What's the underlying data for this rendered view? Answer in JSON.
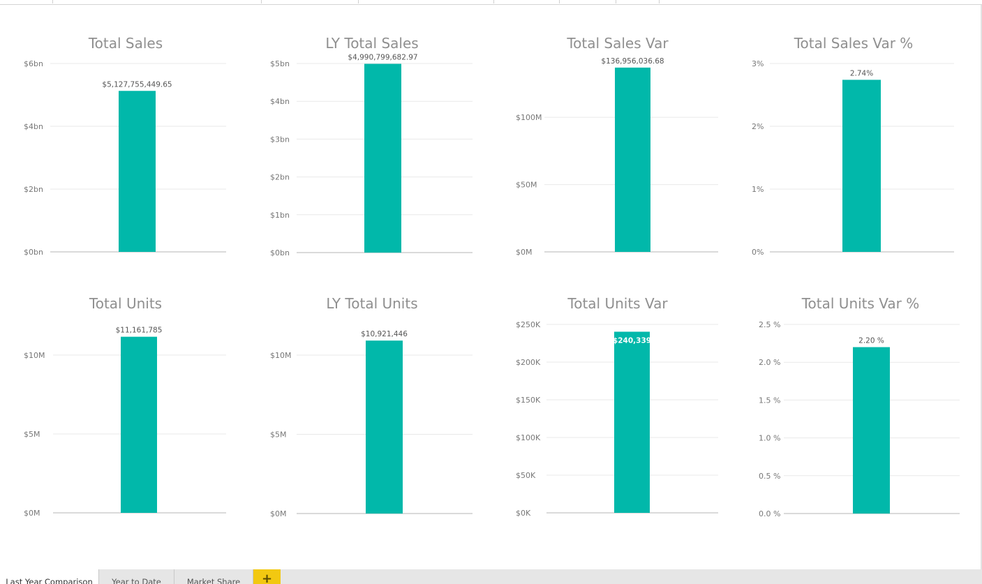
{
  "report": {
    "tabs": [
      {
        "label": "Last Year Comparison",
        "active": true
      },
      {
        "label": "Year to Date",
        "active": false
      },
      {
        "label": "Market Share",
        "active": false
      }
    ],
    "add_tab_label": "+",
    "bar_color": "#01b8aa"
  },
  "chart_data": [
    {
      "type": "bar",
      "title": "Total Sales",
      "categories": [
        ""
      ],
      "values": [
        5127755449.65
      ],
      "data_label": "$5,127,755,449.65",
      "ylim": [
        0,
        6000000000
      ],
      "yticks": [
        {
          "value": 0,
          "label": "$0bn"
        },
        {
          "value": 2000000000,
          "label": "$2bn"
        },
        {
          "value": 4000000000,
          "label": "$4bn"
        },
        {
          "value": 6000000000,
          "label": "$6bn"
        }
      ],
      "grid": true
    },
    {
      "type": "bar",
      "title": "LY Total Sales",
      "categories": [
        ""
      ],
      "values": [
        4990799682.97
      ],
      "data_label": "$4,990,799,682.97",
      "ylim": [
        0,
        5000000000
      ],
      "yticks": [
        {
          "value": 0,
          "label": "$0bn"
        },
        {
          "value": 1000000000,
          "label": "$1bn"
        },
        {
          "value": 2000000000,
          "label": "$2bn"
        },
        {
          "value": 3000000000,
          "label": "$3bn"
        },
        {
          "value": 4000000000,
          "label": "$4bn"
        },
        {
          "value": 5000000000,
          "label": "$5bn"
        }
      ],
      "grid": true
    },
    {
      "type": "bar",
      "title": "Total Sales Var",
      "categories": [
        ""
      ],
      "values": [
        136956036.68
      ],
      "data_label": "$136,956,036.68",
      "ylim": [
        0,
        140000000
      ],
      "yticks": [
        {
          "value": 0,
          "label": "$0M"
        },
        {
          "value": 50000000,
          "label": "$50M"
        },
        {
          "value": 100000000,
          "label": "$100M"
        }
      ],
      "grid": true
    },
    {
      "type": "bar",
      "title": "Total Sales Var %",
      "categories": [
        ""
      ],
      "values": [
        2.74
      ],
      "data_label": "2.74%",
      "ylim": [
        0,
        3
      ],
      "yticks": [
        {
          "value": 0,
          "label": "0%"
        },
        {
          "value": 1,
          "label": "1%"
        },
        {
          "value": 2,
          "label": "2%"
        },
        {
          "value": 3,
          "label": "3%"
        }
      ],
      "grid": true
    },
    {
      "type": "bar",
      "title": "Total Units",
      "categories": [
        ""
      ],
      "values": [
        11161785
      ],
      "data_label": "$11,161,785",
      "ylim": [
        0,
        11500000
      ],
      "yticks": [
        {
          "value": 0,
          "label": "$0M"
        },
        {
          "value": 5000000,
          "label": "$5M"
        },
        {
          "value": 10000000,
          "label": "$10M"
        }
      ],
      "grid": true
    },
    {
      "type": "bar",
      "title": "LY Total Units",
      "categories": [
        ""
      ],
      "values": [
        10921446
      ],
      "data_label": "$10,921,446",
      "ylim": [
        0,
        11500000
      ],
      "yticks": [
        {
          "value": 0,
          "label": "$0M"
        },
        {
          "value": 5000000,
          "label": "$5M"
        },
        {
          "value": 10000000,
          "label": "$10M"
        }
      ],
      "grid": true
    },
    {
      "type": "bar",
      "title": "Total Units Var",
      "categories": [
        ""
      ],
      "values": [
        240339
      ],
      "data_label": "$240,339",
      "data_label_inside": true,
      "ylim": [
        0,
        250000
      ],
      "yticks": [
        {
          "value": 0,
          "label": "$0K"
        },
        {
          "value": 50000,
          "label": "$50K"
        },
        {
          "value": 100000,
          "label": "$100K"
        },
        {
          "value": 150000,
          "label": "$150K"
        },
        {
          "value": 200000,
          "label": "$200K"
        },
        {
          "value": 250000,
          "label": "$250K"
        }
      ],
      "grid": true
    },
    {
      "type": "bar",
      "title": "Total Units Var %",
      "categories": [
        ""
      ],
      "values": [
        2.2
      ],
      "data_label": "2.20 %",
      "ylim": [
        0,
        2.5
      ],
      "yticks": [
        {
          "value": 0,
          "label": "0.0 %"
        },
        {
          "value": 0.5,
          "label": "0.5 %"
        },
        {
          "value": 1,
          "label": "1.0 %"
        },
        {
          "value": 1.5,
          "label": "1.5 %"
        },
        {
          "value": 2,
          "label": "2.0 %"
        },
        {
          "value": 2.5,
          "label": "2.5 %"
        }
      ],
      "grid": true
    }
  ]
}
